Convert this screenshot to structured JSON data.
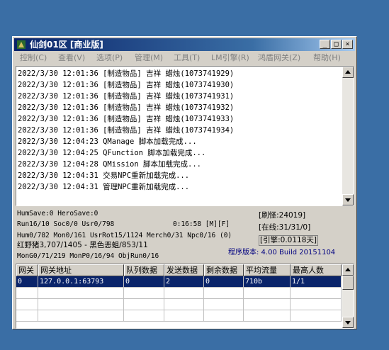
{
  "window": {
    "title": "仙剑01区 [商业版]",
    "controls": {
      "minimize": "_",
      "maximize": "□",
      "close": "×"
    }
  },
  "menu": [
    "控制(C)",
    "查看(V)",
    "选项(P)",
    "管理(M)",
    "工具(T)",
    "LM引擎(R)",
    "鸿盾网关(Z)",
    "帮助(H)"
  ],
  "log": [
    "2022/3/30 12:01:36 [制造物品] 吉祥 蜡烛(1073741929)",
    "2022/3/30 12:01:36 [制造物品] 吉祥 蜡烛(1073741930)",
    "2022/3/30 12:01:36 [制造物品] 吉祥 蜡烛(1073741931)",
    "2022/3/30 12:01:36 [制造物品] 吉祥 蜡烛(1073741932)",
    "2022/3/30 12:01:36 [制造物品] 吉祥 蜡烛(1073741933)",
    "2022/3/30 12:01:36 [制造物品] 吉祥 蜡烛(1073741934)",
    "2022/3/30 12:04:23 QManage 脚本加载完成...",
    "2022/3/30 12:04:25 QFunction 脚本加载完成...",
    "2022/3/30 12:04:28 QMission 脚本加载完成...",
    "2022/3/30 12:04:31 交易NPC重新加载完成...",
    "2022/3/30 12:04:31 管理NPC重新加载完成..."
  ],
  "stats": {
    "line1": "HumSave:0 HeroSave:0",
    "line2": "Run16/10 Soc0/0 Usr0/798",
    "timer": "0:16:58 [M][F]",
    "line3": "Hum0/782 Mon0/161 UsrRot15/1124 Merch0/31 Npc0/16 (0)",
    "line4": "红野猪3,707/1405 - 黑色恶蛆/853/11",
    "line5": "MonG0/71/219 MonP0/16/94 ObjRun0/16",
    "refresh": "[刷怪:24019]",
    "online": "[在线:31/31/0]",
    "engine": "[引擎:0.0118天]",
    "version": "程序版本: 4.00 Build 20151104"
  },
  "grid": {
    "headers": [
      "网关",
      "网关地址",
      "队列数据",
      "发送数据",
      "剩余数据",
      "平均流量",
      "最高人数"
    ],
    "rows": [
      [
        "0",
        "127.0.0.1:63793",
        "0",
        "2",
        "0",
        "710b",
        "1/1"
      ]
    ]
  },
  "colors": {
    "titlebar": "#0a246a",
    "selection": "#0a246a",
    "desktop": "#3a6ea5",
    "version_text": "#000080"
  }
}
